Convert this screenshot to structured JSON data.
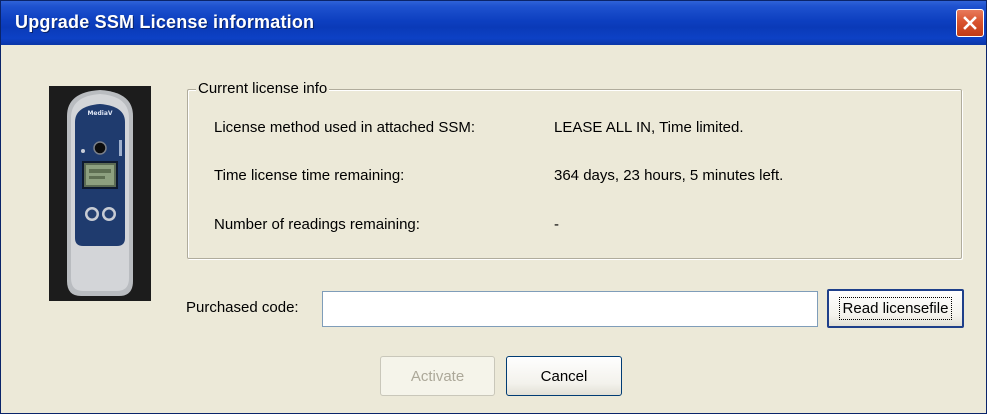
{
  "window": {
    "title": "Upgrade SSM License information"
  },
  "device_image": {
    "brand_text": "MediaV"
  },
  "license_group": {
    "legend": "Current license info",
    "rows": [
      {
        "label": "License method used in attached SSM:",
        "value": "LEASE ALL IN, Time limited."
      },
      {
        "label": "Time license time remaining:",
        "value": "364 days, 23 hours, 5 minutes left."
      },
      {
        "label": "Number of readings remaining:",
        "value": "-"
      }
    ]
  },
  "purchase": {
    "label": "Purchased code:",
    "value": "",
    "read_button": "Read licensefile"
  },
  "buttons": {
    "activate": "Activate",
    "cancel": "Cancel"
  },
  "colors": {
    "titlebar": "#0a3ab8",
    "dialog_bg": "#ece9d8",
    "close_button": "#d9542f"
  }
}
